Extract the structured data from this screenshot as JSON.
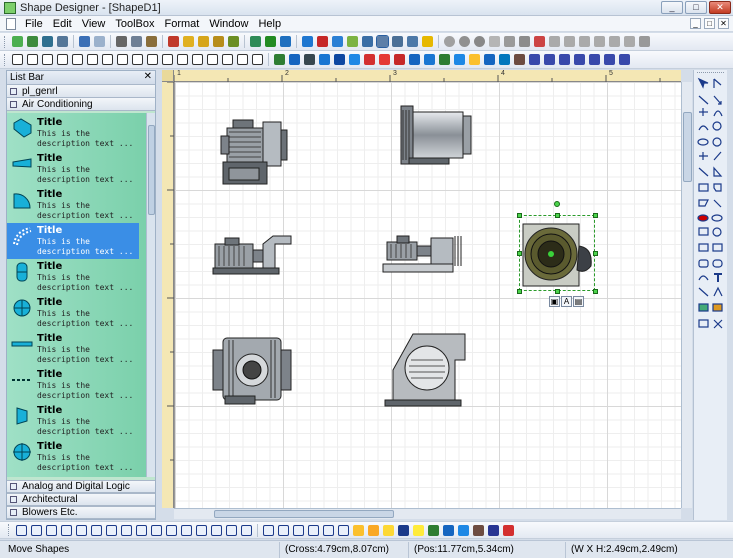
{
  "window": {
    "title": "Shape Designer - [ShapeD1]",
    "controls": {
      "minimize": "_",
      "maximize": "□",
      "close": "✕"
    }
  },
  "menu": {
    "items": [
      "File",
      "Edit",
      "View",
      "ToolBox",
      "Format",
      "Window",
      "Help"
    ],
    "mdi_controls": [
      "_",
      "□",
      "✕"
    ]
  },
  "listbar": {
    "title": "List Bar",
    "close": "✕",
    "categories_top": [
      "pl_genrl",
      "Air Conditioning"
    ],
    "items": [
      {
        "title": "Title",
        "desc": "This is the description text ...",
        "icon": "duct-elbow-icon"
      },
      {
        "title": "Title",
        "desc": "This is the description text ...",
        "icon": "duct-taper-icon"
      },
      {
        "title": "Title",
        "desc": "This is the description text ...",
        "icon": "fan-quarter-icon"
      },
      {
        "title": "Title",
        "desc": "This is the description text ...",
        "icon": "duct-curve-icon"
      },
      {
        "title": "Title",
        "desc": "This is the description text ...",
        "icon": "damper-icon"
      },
      {
        "title": "Title",
        "desc": "This is the description text ...",
        "icon": "diffuser-icon"
      },
      {
        "title": "Title",
        "desc": "This is the description text ...",
        "icon": "duct-line-icon"
      },
      {
        "title": "Title",
        "desc": "This is the description text ...",
        "icon": "dashed-line-icon"
      },
      {
        "title": "Title",
        "desc": "This is the description text ...",
        "icon": "valve-icon"
      },
      {
        "title": "Title",
        "desc": "This is the description text ...",
        "icon": "grille-icon"
      }
    ],
    "selected_index": 3,
    "categories_bottom": [
      "Analog and Digital Logic",
      "Architectural",
      "Blowers Etc."
    ]
  },
  "ruler": {
    "top_labels": [
      "1",
      "2",
      "3",
      "4",
      "5"
    ]
  },
  "status": {
    "mode": "Move Shapes",
    "cross": "(Cross:4.79cm,8.07cm)",
    "pos": "(Pos:11.77cm,5.34cm)",
    "size": "(W X H:2.49cm,2.49cm)"
  },
  "colors": {
    "accent": "#3a8ee6",
    "listbar_bg": "#8fd9b9",
    "selection": "#2a9b2a",
    "ruler": "#f4e7b4"
  }
}
